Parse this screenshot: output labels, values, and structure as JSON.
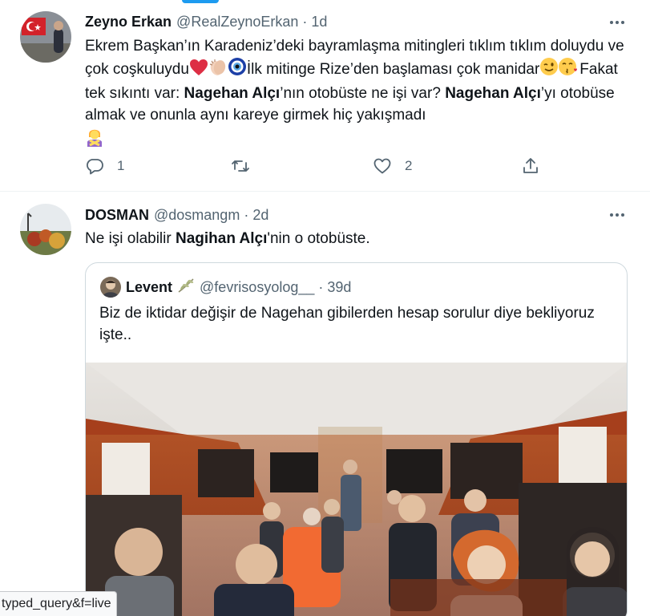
{
  "tweets": [
    {
      "name": "Zeyno Erkan",
      "handle": "@RealZeynoErkan",
      "dot": "·",
      "time": "1d",
      "text": {
        "p1": "Ekrem Başkan’ın Karadeniz’deki bayramlaşma mitingleri tıklım tıklım doluydu ve çok coşkuluydu",
        "p2": "İlk mitinge Rize’den başlaması çok manidar",
        "p3": "Fakat tek sıkıntı var: ",
        "b1": "Nagehan Alçı",
        "p4": "’nın otobüste ne işi var? ",
        "b2": "Nagehan Alçı",
        "p5": "’yı otobüse almak ve onunla aynı kareye girmek hiç yakışmadı"
      },
      "emojis": [
        "red-heart-icon",
        "clapping-hands-icon",
        "nazar-amulet-icon",
        "winking-face-icon",
        "face-blowing-kiss-icon",
        "person-gesturing-no-icon"
      ],
      "actions": {
        "replies": "1",
        "retweets": "",
        "likes": "2"
      }
    },
    {
      "name": "DOSMAN",
      "handle": "@dosmangm",
      "dot": "·",
      "time": "2d",
      "text": {
        "p1": "Ne işi olabilir ",
        "b1": "Nagihan Alçı",
        "p2": "'nin o otobüste."
      },
      "quote": {
        "name": "Levent",
        "badge": "olive-branch-icon",
        "handle": "@fevrisosyolog__",
        "dot": "·",
        "time": "39d",
        "text": "Biz de iktidar değişir de Nagehan gibilerden hesap sorulur diye bekliyoruz işte.."
      }
    }
  ],
  "status_url": "typed_query&f=live",
  "colors": {
    "accent": "#1d9bf0",
    "secondary_text": "#536471",
    "border": "#cfd9de",
    "heart": "#e0245e"
  }
}
